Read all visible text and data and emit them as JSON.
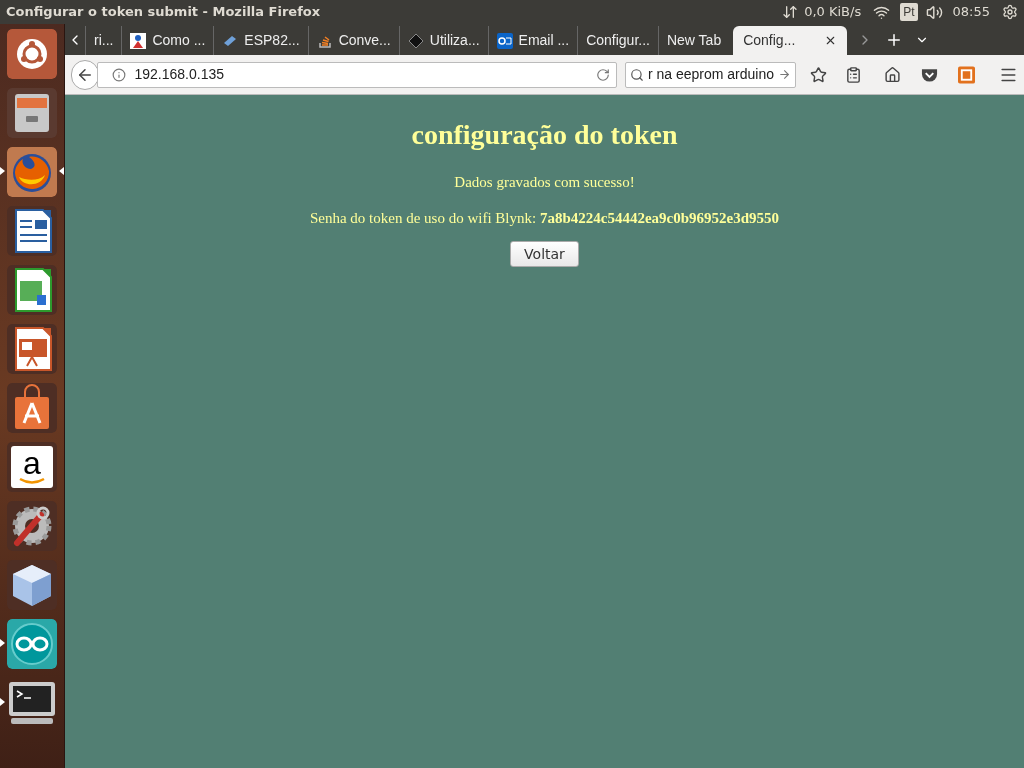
{
  "top_panel": {
    "title": "Configurar o token submit - Mozilla Firefox",
    "network": "0,0 KiB/s",
    "keyboard": "Pt",
    "time": "08:55"
  },
  "launcher": [
    {
      "kind": "ubuntu",
      "running": false,
      "focused": false
    },
    {
      "kind": "files",
      "running": false,
      "focused": false
    },
    {
      "kind": "firefox",
      "running": true,
      "focused": true
    },
    {
      "kind": "writer",
      "running": false,
      "focused": false
    },
    {
      "kind": "calc",
      "running": false,
      "focused": false
    },
    {
      "kind": "impress",
      "running": false,
      "focused": false
    },
    {
      "kind": "store",
      "running": false,
      "focused": false
    },
    {
      "kind": "amazon",
      "glyph": "a",
      "running": false,
      "focused": false
    },
    {
      "kind": "settings",
      "running": false,
      "focused": false
    },
    {
      "kind": "cube",
      "running": false,
      "focused": false
    },
    {
      "kind": "arduino",
      "running": true,
      "focused": false
    },
    {
      "kind": "terminal",
      "running": true,
      "focused": false
    }
  ],
  "tabs": [
    {
      "label": "ri...",
      "kind": "plain",
      "selected": false
    },
    {
      "label": "Como ...",
      "kind": "figure",
      "selected": false
    },
    {
      "label": "ESP82...",
      "kind": "chip",
      "selected": false
    },
    {
      "label": "Conve...",
      "kind": "stack",
      "selected": false
    },
    {
      "label": "Utiliza...",
      "kind": "diamond",
      "selected": false
    },
    {
      "label": "Email ...",
      "kind": "mail",
      "selected": false
    },
    {
      "label": "Configur...",
      "kind": "plain",
      "selected": false
    },
    {
      "label": "New Tab",
      "kind": "plain",
      "selected": false
    },
    {
      "label": "Config...",
      "kind": "plain",
      "selected": true
    }
  ],
  "nav": {
    "url": "192.168.0.135",
    "search": "r na eeprom arduino"
  },
  "page": {
    "heading": "configuração do token",
    "message": "Dados gravados com sucesso!",
    "token_line": "Senha do token de uso do wifi Blynk: **7a8b4224c54442ea9c0b96952e3d9550**",
    "button": "Voltar"
  }
}
